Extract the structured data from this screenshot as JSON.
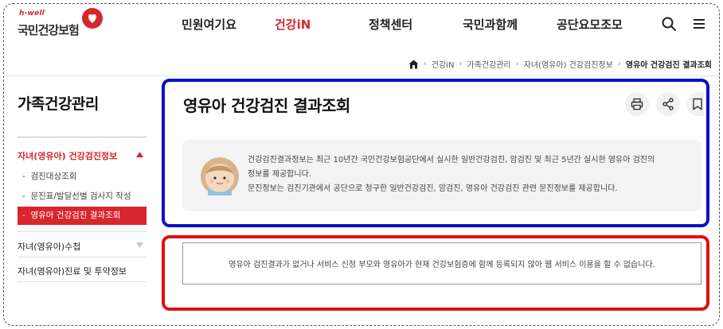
{
  "logo": {
    "sub": "h-well",
    "main": "국민건강보험"
  },
  "gnb": {
    "items": [
      {
        "label": "민원여기요",
        "active": false
      },
      {
        "label": "건강iN",
        "active": true
      },
      {
        "label": "정책센터",
        "active": false
      },
      {
        "label": "국민과함께",
        "active": false
      },
      {
        "label": "공단요모조모",
        "active": false
      }
    ],
    "icons": [
      "search-icon",
      "menu-icon"
    ]
  },
  "breadcrumb": {
    "items": [
      "건강iN",
      "가족건강관리",
      "자녀(영유아) 건강검진정보",
      "영유아 건강검진 결과조회"
    ]
  },
  "sidebar": {
    "title": "가족건강관리",
    "groups": [
      {
        "label": "자녀(영유아) 건강검진정보",
        "expanded": true,
        "items": [
          {
            "label": "검진대상조회",
            "active": false
          },
          {
            "label": "문진표/발달선별 검사지 작성",
            "active": false
          },
          {
            "label": "영유아 건강검진 결과조회",
            "active": true
          }
        ]
      },
      {
        "label": "자녀(영유아)수첩",
        "expanded": false,
        "items": []
      },
      {
        "label": "자녀(영유아)진료 및 투약정보",
        "expanded": false,
        "items": []
      }
    ]
  },
  "main": {
    "title": "영유아 건강검진 결과조회",
    "tools": [
      "print-icon",
      "share-icon",
      "bookmark-icon"
    ],
    "info": {
      "line1": "건강검진결과정보는 최근 10년간 국민건강보험공단에서 실시한 일반건강검진, 암검진 및 최근 5년간 실시한 영유아 검진의",
      "line2": "정보를 제공합니다.",
      "line3": "문진정보는 검진기관에서 공단으로 청구한 일반건강검진, 암검진, 영유아 건강검진 관련 문진정보를 제공합니다."
    },
    "result_message": "영유아 검진결과가 없거나 서비스 신청 부모와 영유아가 현재 건강보험증에 함께 등록되지 않아 웹 서비스 이용을 할 수 없습니다."
  },
  "colors": {
    "brand_red": "#d7262e",
    "highlight_blue": "#0a10c4",
    "highlight_red": "#e01010"
  }
}
